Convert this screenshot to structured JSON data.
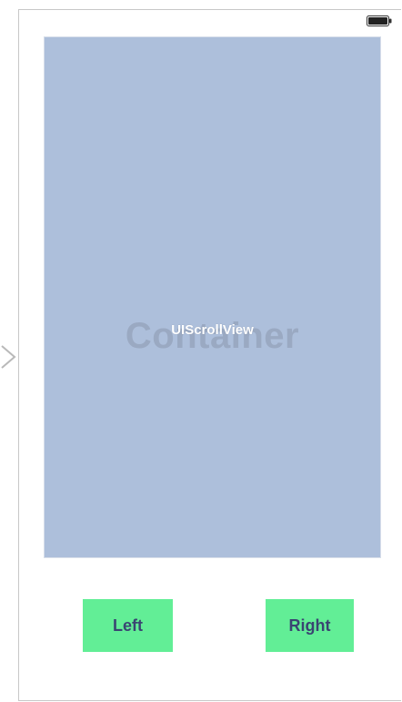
{
  "scroll_view": {
    "background_label": "Container",
    "label": "UIScrollView",
    "color": "#adbfdb"
  },
  "buttons": {
    "left_label": "Left",
    "right_label": "Right",
    "color": "#62ee96",
    "text_color": "#3a4572"
  },
  "icons": {
    "entry_arrow": "chevron-right-icon",
    "battery": "battery-icon"
  }
}
